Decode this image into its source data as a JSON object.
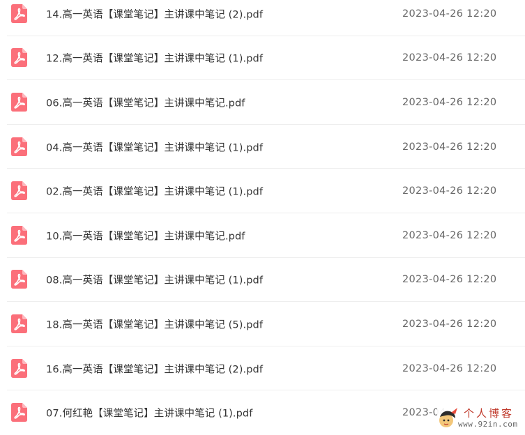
{
  "colors": {
    "icon_bg": "#fb6f7a",
    "icon_fold": "#fdb8be",
    "text": "#333333",
    "time": "#666666",
    "divider": "#eeeeee"
  },
  "files": [
    {
      "name": "14.高一英语【课堂笔记】主讲课中笔记 (2).pdf",
      "time": "2023-04-26 12:20",
      "icon": "pdf-icon"
    },
    {
      "name": "12.高一英语【课堂笔记】主讲课中笔记 (1).pdf",
      "time": "2023-04-26 12:20",
      "icon": "pdf-icon"
    },
    {
      "name": "06.高一英语【课堂笔记】主讲课中笔记.pdf",
      "time": "2023-04-26 12:20",
      "icon": "pdf-icon"
    },
    {
      "name": "04.高一英语【课堂笔记】主讲课中笔记 (1).pdf",
      "time": "2023-04-26 12:20",
      "icon": "pdf-icon"
    },
    {
      "name": "02.高一英语【课堂笔记】主讲课中笔记 (1).pdf",
      "time": "2023-04-26 12:20",
      "icon": "pdf-icon"
    },
    {
      "name": "10.高一英语【课堂笔记】主讲课中笔记.pdf",
      "time": "2023-04-26 12:20",
      "icon": "pdf-icon"
    },
    {
      "name": "08.高一英语【课堂笔记】主讲课中笔记 (1).pdf",
      "time": "2023-04-26 12:20",
      "icon": "pdf-icon"
    },
    {
      "name": "18.高一英语【课堂笔记】主讲课中笔记 (5).pdf",
      "time": "2023-04-26 12:20",
      "icon": "pdf-icon"
    },
    {
      "name": "16.高一英语【课堂笔记】主讲课中笔记 (2).pdf",
      "time": "2023-04-26 12:20",
      "icon": "pdf-icon"
    },
    {
      "name": "07.何红艳【课堂笔记】主讲课中笔记 (1).pdf",
      "time": "2023-04",
      "icon": "pdf-icon"
    }
  ],
  "watermark": {
    "title": "个人博客",
    "domain": "www.92in.com",
    "icon": "blog-logo-icon"
  }
}
